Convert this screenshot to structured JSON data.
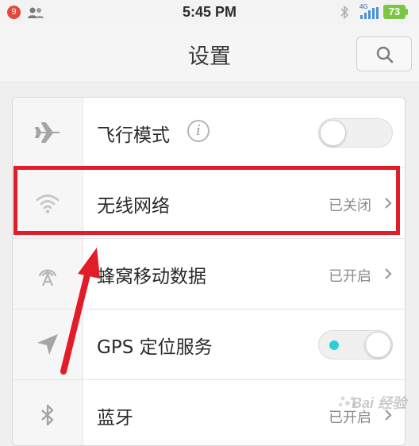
{
  "status_bar": {
    "notification_count": "9",
    "time": "5:45 PM",
    "network_type": "4G",
    "battery": "73",
    "icons": [
      "contacts-icon",
      "bluetooth-icon",
      "signal-icon",
      "battery-icon"
    ]
  },
  "header": {
    "title": "设置",
    "search_icon": "search-icon"
  },
  "settings": {
    "rows": [
      {
        "label": "飞行模式",
        "icon": "airplane-icon",
        "control": "toggle",
        "state": "off"
      },
      {
        "label": "无线网络",
        "icon": "wifi-icon",
        "value": "已关闭",
        "control": "chevron"
      },
      {
        "label": "蜂窝移动数据",
        "icon": "cellular-icon",
        "value": "已开启",
        "control": "chevron"
      },
      {
        "label": "GPS 定位服务",
        "icon": "location-icon",
        "control": "toggle",
        "state": "on"
      },
      {
        "label": "蓝牙",
        "icon": "bluetooth-icon",
        "value": "已开启",
        "control": "chevron"
      }
    ]
  },
  "watermark": {
    "text": "Bai 经验"
  },
  "colors": {
    "highlight": "#e11d2a",
    "toggle_on_dot": "#2ad0d7",
    "battery": "#7dc544",
    "badge": "#e5483b"
  }
}
